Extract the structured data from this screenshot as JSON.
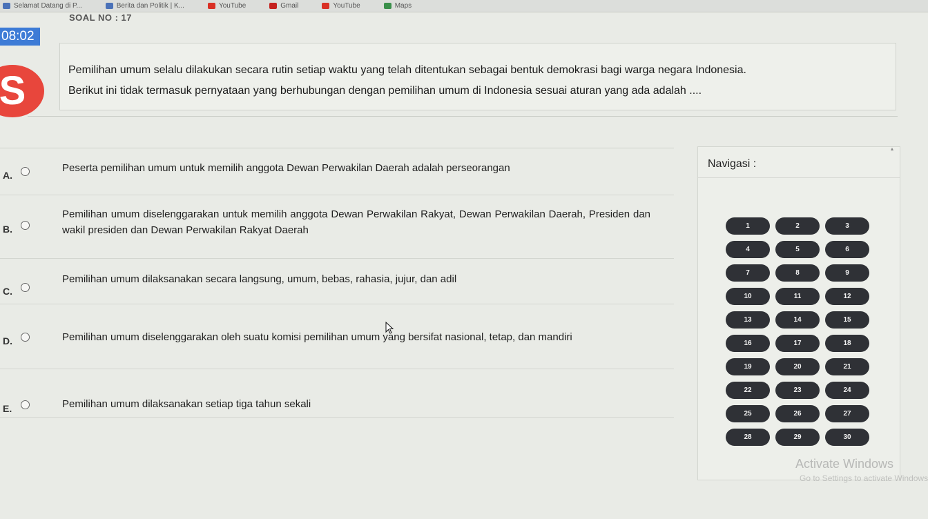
{
  "bookmarks": [
    {
      "label": "Selamat Datang di P...",
      "icon": "page-icon"
    },
    {
      "label": "Berita dan Politik | K...",
      "icon": "page-icon"
    },
    {
      "label": "YouTube",
      "icon": "youtube-icon"
    },
    {
      "label": "Gmail",
      "icon": "gmail-icon"
    },
    {
      "label": "YouTube",
      "icon": "youtube-icon"
    },
    {
      "label": "Maps",
      "icon": "maps-icon"
    }
  ],
  "header": {
    "soal_no": "SOAL NO : 17",
    "timer": "08:02",
    "avatar_letter": "S"
  },
  "question": {
    "line1": "Pemilihan umum selalu dilakukan secara rutin setiap waktu yang telah ditentukan sebagai bentuk demokrasi bagi warga negara Indonesia.",
    "line2": "Berikut ini tidak termasuk pernyataan yang berhubungan dengan pemilihan umum di Indonesia sesuai aturan yang ada adalah ...."
  },
  "options": [
    {
      "letter": "A.",
      "text": "Peserta pemilihan umum untuk memilih anggota Dewan Perwakilan Daerah adalah perseorangan"
    },
    {
      "letter": "B.",
      "text": "Pemilihan umum diselenggarakan untuk memilih anggota Dewan Perwakilan Rakyat, Dewan Perwakilan Daerah, Presiden dan wakil presiden dan Dewan Perwakilan Rakyat Daerah"
    },
    {
      "letter": "C.",
      "text": "Pemilihan umum dilaksanakan secara langsung, umum, bebas, rahasia, jujur, dan adil"
    },
    {
      "letter": "D.",
      "text": "Pemilihan umum diselenggarakan oleh suatu komisi pemilihan umum yang bersifat nasional, tetap, dan mandiri"
    },
    {
      "letter": "E.",
      "text": "Pemilihan umum dilaksanakan setiap tiga tahun sekali"
    }
  ],
  "navigation": {
    "title": "Navigasi :",
    "numbers": [
      "1",
      "2",
      "3",
      "4",
      "5",
      "6",
      "7",
      "8",
      "9",
      "10",
      "11",
      "12",
      "13",
      "14",
      "15",
      "16",
      "17",
      "18",
      "19",
      "20",
      "21",
      "22",
      "23",
      "24",
      "25",
      "26",
      "27",
      "28",
      "29",
      "30"
    ]
  },
  "watermark": {
    "line1": "Activate Windows",
    "line2": "Go to Settings to activate Windows."
  },
  "colors": {
    "timer_bg": "#3d7bd6",
    "avatar_bg": "#e8463c",
    "nav_button_bg": "#2f3136"
  }
}
